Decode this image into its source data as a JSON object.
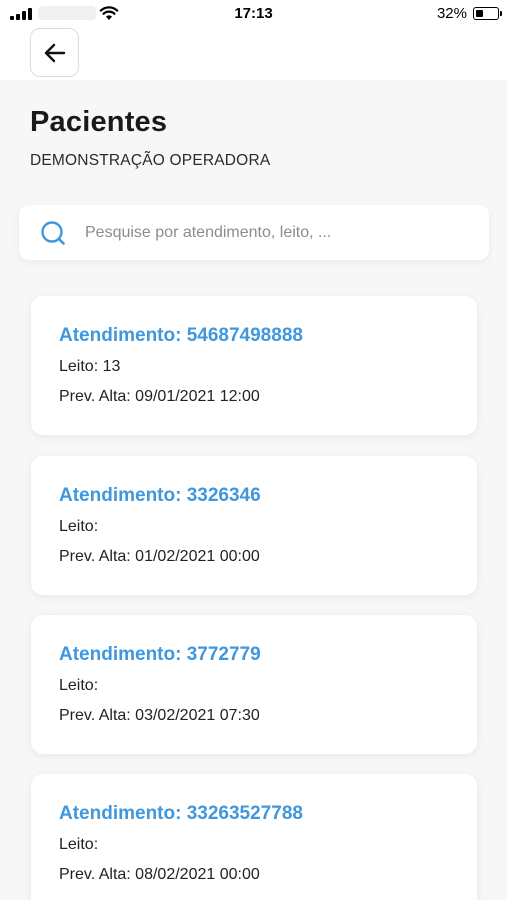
{
  "status_bar": {
    "time": "17:13",
    "battery_percent": "32%"
  },
  "header": {
    "title": "Pacientes",
    "subtitle": "DEMONSTRAÇÃO OPERADORA"
  },
  "search": {
    "placeholder": "Pesquise por atendimento, leito, ..."
  },
  "colors": {
    "accent": "#3f97de",
    "background": "#f7f7f7"
  },
  "patients": [
    {
      "title": "Atendimento: 54687498888",
      "bed": "Leito: 13",
      "discharge": "Prev. Alta: 09/01/2021 12:00"
    },
    {
      "title": "Atendimento: 3326346",
      "bed": "Leito:",
      "discharge": "Prev. Alta: 01/02/2021 00:00"
    },
    {
      "title": "Atendimento: 3772779",
      "bed": "Leito:",
      "discharge": "Prev. Alta: 03/02/2021 07:30"
    },
    {
      "title": "Atendimento: 33263527788",
      "bed": "Leito:",
      "discharge": "Prev. Alta: 08/02/2021 00:00"
    }
  ]
}
